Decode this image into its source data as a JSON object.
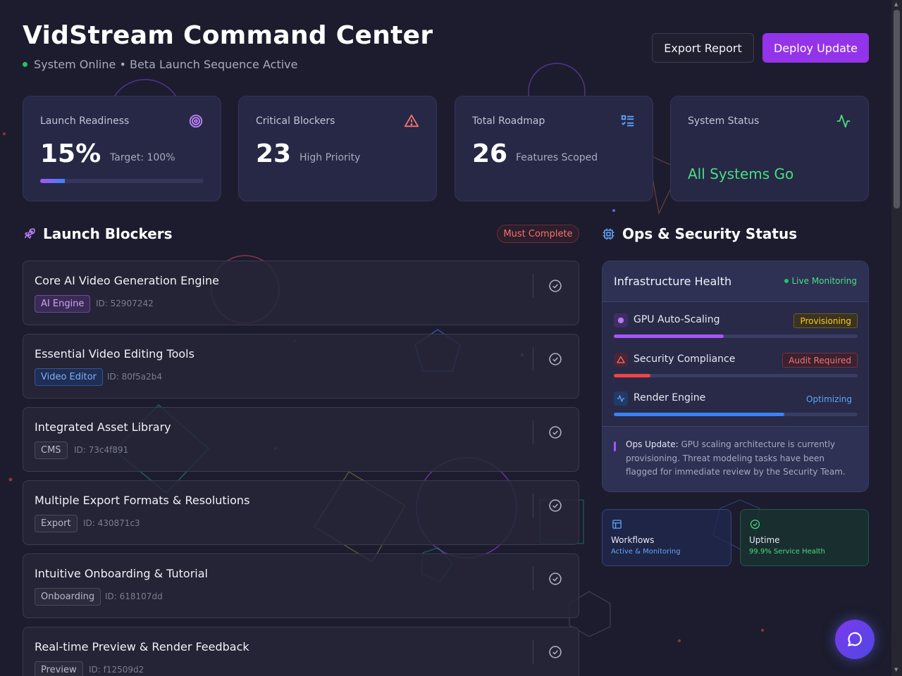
{
  "header": {
    "title": "VidStream Command Center",
    "status_text": "System Online • Beta Launch Sequence Active",
    "export_label": "Export Report",
    "deploy_label": "Deploy Update"
  },
  "stats": [
    {
      "label": "Launch Readiness",
      "value": "15%",
      "sub": "Target: 100%",
      "progress": 0.15,
      "icon": "target-icon"
    },
    {
      "label": "Critical Blockers",
      "value": "23",
      "sub": "High Priority",
      "icon": "alert-triangle-icon"
    },
    {
      "label": "Total Roadmap",
      "value": "26",
      "sub": "Features Scoped",
      "icon": "list-checks-icon"
    },
    {
      "label": "System Status",
      "value": "All Systems Go",
      "icon": "activity-icon"
    }
  ],
  "blockers_section": {
    "title": "Launch Blockers",
    "badge": "Must Complete",
    "items": [
      {
        "title": "Core AI Video Generation Engine",
        "tag": "AI Engine",
        "id": "ID: 52907242"
      },
      {
        "title": "Essential Video Editing Tools",
        "tag": "Video Editor",
        "id": "ID: 80f5a2b4"
      },
      {
        "title": "Integrated Asset Library",
        "tag": "CMS",
        "id": "ID: 73c4f891"
      },
      {
        "title": "Multiple Export Formats & Resolutions",
        "tag": "Export",
        "id": "ID: 430871c3"
      },
      {
        "title": "Intuitive Onboarding & Tutorial",
        "tag": "Onboarding",
        "id": "ID: 618107dd"
      },
      {
        "title": "Real-time Preview & Render Feedback",
        "tag": "Preview",
        "id": "ID: f12509d2"
      }
    ]
  },
  "ops_section": {
    "title": "Ops & Security Status",
    "panel_title": "Infrastructure Health",
    "live_label": "Live Monitoring",
    "rows": [
      {
        "label": "GPU Auto-Scaling",
        "status": "Provisioning",
        "progress": 0.45,
        "color": "#a855f7"
      },
      {
        "label": "Security Compliance",
        "status": "Audit Required",
        "progress": 0.15,
        "color": "#ef4444"
      },
      {
        "label": "Render Engine",
        "status": "Optimizing",
        "progress": 0.7,
        "color": "#3b82f6"
      }
    ],
    "update_label": "Ops Update:",
    "update_text": "GPU scaling architecture is currently provisioning. Threat modeling tasks have been flagged for immediate review by the Security Team.",
    "mini_cards": [
      {
        "title": "Workflows",
        "sub": "Active & Monitoring",
        "icon": "layout-icon",
        "color": "#60a5fa"
      },
      {
        "title": "Uptime",
        "sub": "99.9% Service Health",
        "icon": "check-circle-icon",
        "color": "#4ade80"
      }
    ]
  },
  "colors": {
    "accent_purple": "#9333ea",
    "success_green": "#4ade80",
    "danger_red": "#f87171",
    "warning_yellow": "#facc15",
    "info_blue": "#60a5fa"
  }
}
